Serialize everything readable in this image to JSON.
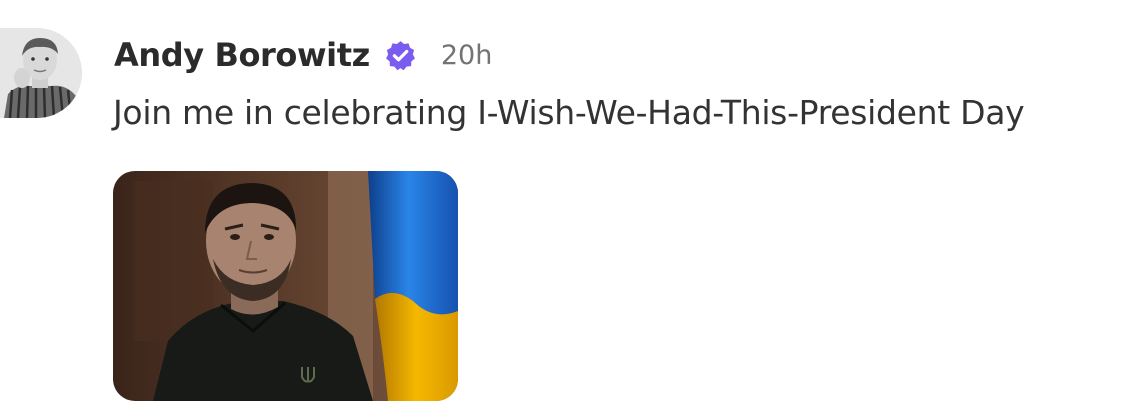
{
  "post": {
    "author": {
      "name": "Andy Borowitz",
      "verified_icon": "verified-badge-icon",
      "badge_color": "#7b5cf0"
    },
    "timestamp": "20h",
    "text": "Join me in celebrating I-Wish-We-Had-This-President Day",
    "media": {
      "kind": "photo",
      "flag_colors": [
        "#1d6fd6",
        "#f2b600"
      ]
    }
  }
}
